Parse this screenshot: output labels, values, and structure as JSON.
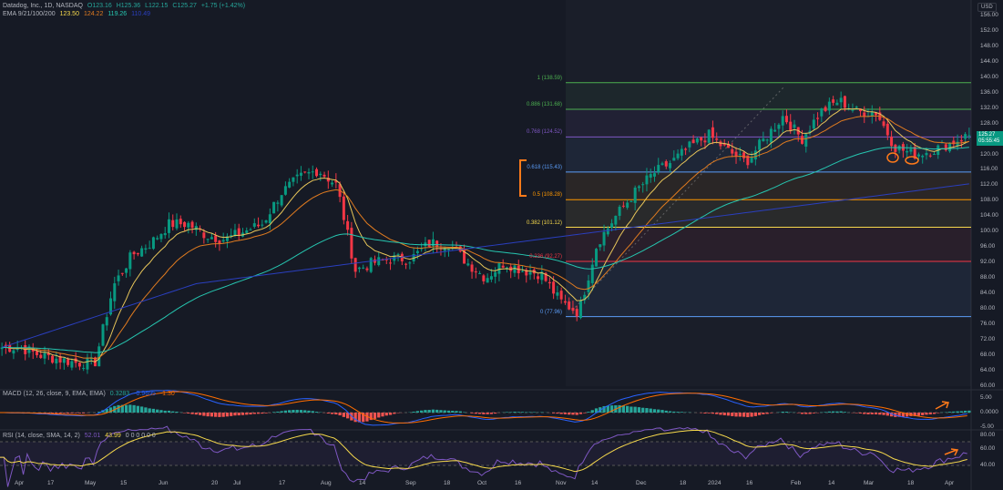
{
  "header": {
    "symbol": "Datadog, Inc., 1D, NASDAQ",
    "open": "O123.16",
    "high": "H125.36",
    "low": "L122.15",
    "close": "C125.27",
    "change": "+1.75 (+1.42%)"
  },
  "ema_legend": {
    "label": "EMA 9/21/100/200",
    "v9": "123.50",
    "v21": "124.22",
    "v100": "119.26",
    "v200": "110.49"
  },
  "macd_legend": {
    "label": "MACD (12, 26, close, 9, EMA, EMA)",
    "hist": "0.3283",
    "macd": "-0.9695",
    "signal": "-1.30"
  },
  "rsi_legend": {
    "label": "RSI (14, close, SMA, 14, 2)",
    "rsi": "52.01",
    "ma": "43.99",
    "extra": "0 0 0 0 0 0"
  },
  "price_axis": {
    "currency": "USD",
    "ticks": [
      "156.00",
      "152.00",
      "148.00",
      "144.00",
      "140.00",
      "136.00",
      "132.00",
      "128.00",
      "120.00",
      "116.00",
      "112.00",
      "108.00",
      "104.00",
      "100.00",
      "96.00",
      "92.00",
      "88.00",
      "84.00",
      "80.00",
      "76.00",
      "72.00",
      "68.00",
      "64.00",
      "60.00"
    ],
    "last_price": "125.27",
    "countdown": "05:55:45"
  },
  "macd_axis": [
    "5.00",
    "0.0000",
    "-5.00"
  ],
  "rsi_axis": [
    "80.00",
    "60.00",
    "40.00"
  ],
  "date_axis": [
    "Apr",
    "17",
    "May",
    "15",
    "Jun",
    "20",
    "Jul",
    "17",
    "Aug",
    "14",
    "Sep",
    "18",
    "Oct",
    "16",
    "Nov",
    "14",
    "Dec",
    "18",
    "2024",
    "16",
    "Feb",
    "14",
    "Mar",
    "18",
    "Apr"
  ],
  "fib_levels": [
    {
      "ratio": "1",
      "price": 138.59,
      "label": "1 (138.59)",
      "color": "#4caf50"
    },
    {
      "ratio": "0.886",
      "price": 131.68,
      "label": "0.886 (131.68)",
      "color": "#4caf50"
    },
    {
      "ratio": "0.768",
      "price": 124.52,
      "label": "0.768 (124.52)",
      "color": "#7e57c2"
    },
    {
      "ratio": "0.618",
      "price": 115.43,
      "label": "0.618 (115.43)",
      "color": "#5b9cf6"
    },
    {
      "ratio": "0.5",
      "price": 108.28,
      "label": "0.5 (108.28)",
      "color": "#ff9800"
    },
    {
      "ratio": "0.382",
      "price": 101.12,
      "label": "0.382 (101.12)",
      "color": "#f6d94c"
    },
    {
      "ratio": "0.236",
      "price": 92.27,
      "label": "0.236 (92.27)",
      "color": "#f23645"
    },
    {
      "ratio": "0",
      "price": 77.96,
      "label": "0 (77.96)",
      "color": "#5b9cf6"
    }
  ],
  "colors": {
    "up": "#089981",
    "down": "#f23645",
    "ema9": "#e8c65a",
    "ema21": "#e07b20",
    "ema100": "#26c6b0",
    "ema200": "#2a3fbf",
    "annotation": "#ff7a1a"
  },
  "chart_data": {
    "type": "candlestick",
    "close_keypoints": [
      70,
      70,
      68,
      67,
      66,
      66,
      86,
      94,
      97,
      102,
      102,
      99,
      98,
      100,
      102,
      110,
      114,
      116,
      112,
      90,
      92,
      93,
      93,
      97,
      97,
      92,
      88,
      92,
      90,
      89,
      82,
      79,
      97,
      104,
      110,
      115,
      118,
      122,
      125,
      121,
      118,
      124,
      130,
      124,
      131,
      134,
      131,
      131,
      122,
      120,
      121,
      123,
      125
    ]
  }
}
